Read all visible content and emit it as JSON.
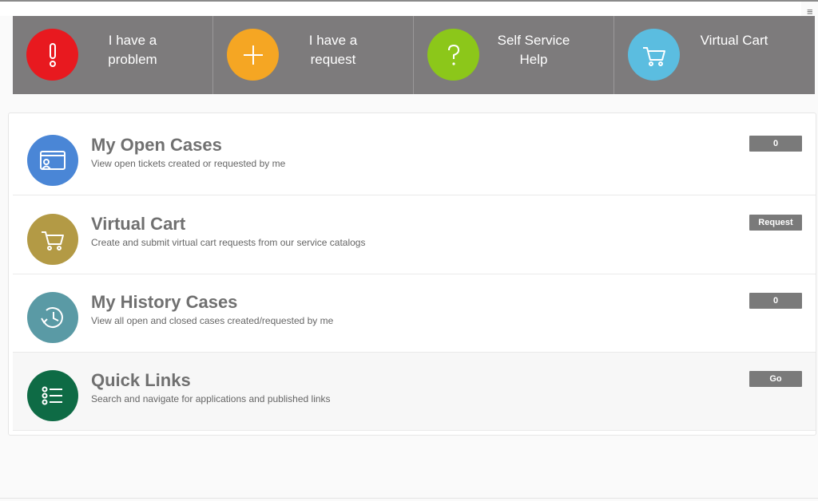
{
  "colors": {
    "tile_bg": "#7d7b7c",
    "problem": "#e8191f",
    "request": "#f5a623",
    "help": "#8cc71a",
    "cart_tile": "#5bbde0",
    "open_cases": "#4a86d6",
    "virtual_cart": "#b39a45",
    "history": "#5a9aa5",
    "quick_links": "#0e6b45",
    "button_bg": "#7a7a7a"
  },
  "menu": {
    "icon": "hamburger-icon",
    "glyph": "≡"
  },
  "tiles": [
    {
      "label": "I have a problem",
      "icon": "exclamation-icon"
    },
    {
      "label": "I have a request",
      "icon": "plus-icon"
    },
    {
      "label": "Self Service Help",
      "icon": "question-icon"
    },
    {
      "label": "Virtual Cart",
      "icon": "cart-icon"
    }
  ],
  "rows": [
    {
      "title": "My Open Cases",
      "description": "View open tickets created or requested by me",
      "button": "0",
      "icon": "open-cases-icon"
    },
    {
      "title": "Virtual Cart",
      "description": "Create and submit virtual cart requests from our service catalogs",
      "button": "Request",
      "icon": "cart-icon"
    },
    {
      "title": "My History Cases",
      "description": "View all open and closed cases created/requested by me",
      "button": "0",
      "icon": "history-icon"
    },
    {
      "title": "Quick Links",
      "description": "Search and navigate for applications and published links",
      "button": "Go",
      "icon": "list-icon"
    }
  ]
}
